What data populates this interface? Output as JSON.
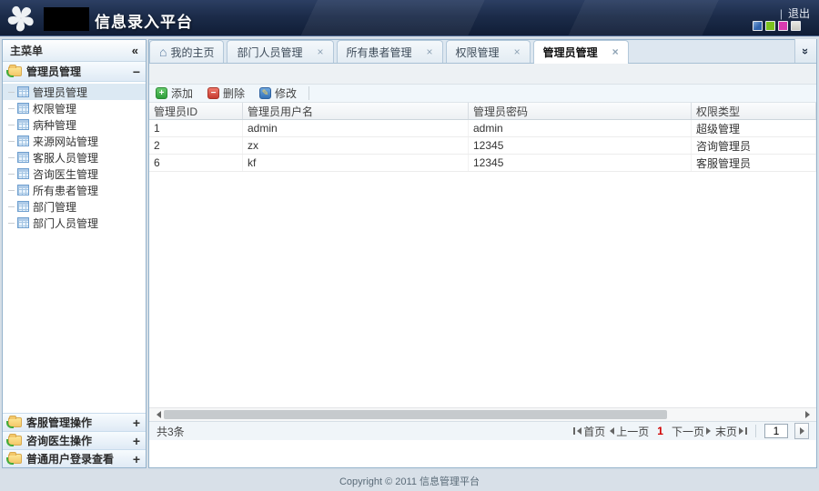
{
  "header": {
    "title": "信息录入平台",
    "logout_label": "退出"
  },
  "sidebar": {
    "title": "主菜单",
    "panels": [
      {
        "label": "管理员管理",
        "state": "expanded"
      },
      {
        "label": "客服管理操作",
        "state": "collapsed"
      },
      {
        "label": "咨询医生操作",
        "state": "collapsed"
      },
      {
        "label": "普通用户登录查看",
        "state": "collapsed"
      }
    ],
    "items": [
      {
        "label": "管理员管理",
        "selected": true
      },
      {
        "label": "权限管理",
        "selected": false
      },
      {
        "label": "病种管理",
        "selected": false
      },
      {
        "label": "来源网站管理",
        "selected": false
      },
      {
        "label": "客服人员管理",
        "selected": false
      },
      {
        "label": "咨询医生管理",
        "selected": false
      },
      {
        "label": "所有患者管理",
        "selected": false
      },
      {
        "label": "部门管理",
        "selected": false
      },
      {
        "label": "部门人员管理",
        "selected": false
      }
    ]
  },
  "tabs": [
    {
      "label": "我的主页",
      "closable": false,
      "active": false
    },
    {
      "label": "部门人员管理",
      "closable": true,
      "active": false
    },
    {
      "label": "所有患者管理",
      "closable": true,
      "active": false
    },
    {
      "label": "权限管理",
      "closable": true,
      "active": false
    },
    {
      "label": "管理员管理",
      "closable": true,
      "active": true
    }
  ],
  "toolbar": {
    "add_label": "添加",
    "delete_label": "删除",
    "edit_label": "修改"
  },
  "table": {
    "columns": [
      "管理员ID",
      "管理员用户名",
      "管理员密码",
      "权限类型"
    ],
    "rows": [
      [
        "1",
        "admin",
        "admin",
        "超级管理"
      ],
      [
        "2",
        "zx",
        "12345",
        "咨询管理员"
      ],
      [
        "6",
        "kf",
        "12345",
        "客服管理员"
      ]
    ]
  },
  "pagination": {
    "total_label": "共3条",
    "first_label": "首页",
    "prev_label": "上一页",
    "current_page": "1",
    "next_label": "下一页",
    "last_label": "末页",
    "page_input_value": "1"
  },
  "footer": {
    "copyright": "Copyright © 2011 信息管理平台"
  },
  "icons": {
    "collapse": "«",
    "minus": "−",
    "plus": "+",
    "close": "×",
    "overflow": "»",
    "home": "⌂",
    "add_glyph": "+",
    "delete_glyph": "−",
    "pencil": "✎",
    "logout_sep": "|"
  },
  "colors": {
    "header_bg": "#1c2c4a",
    "page_bg": "#d5dee7",
    "panel_border": "#95b3cc",
    "current_page_red": "#d10000",
    "theme_blue": "#2f63ad",
    "theme_green": "#7cc220",
    "theme_magenta": "#d93bb1",
    "theme_gray": "#c9c9c2"
  }
}
